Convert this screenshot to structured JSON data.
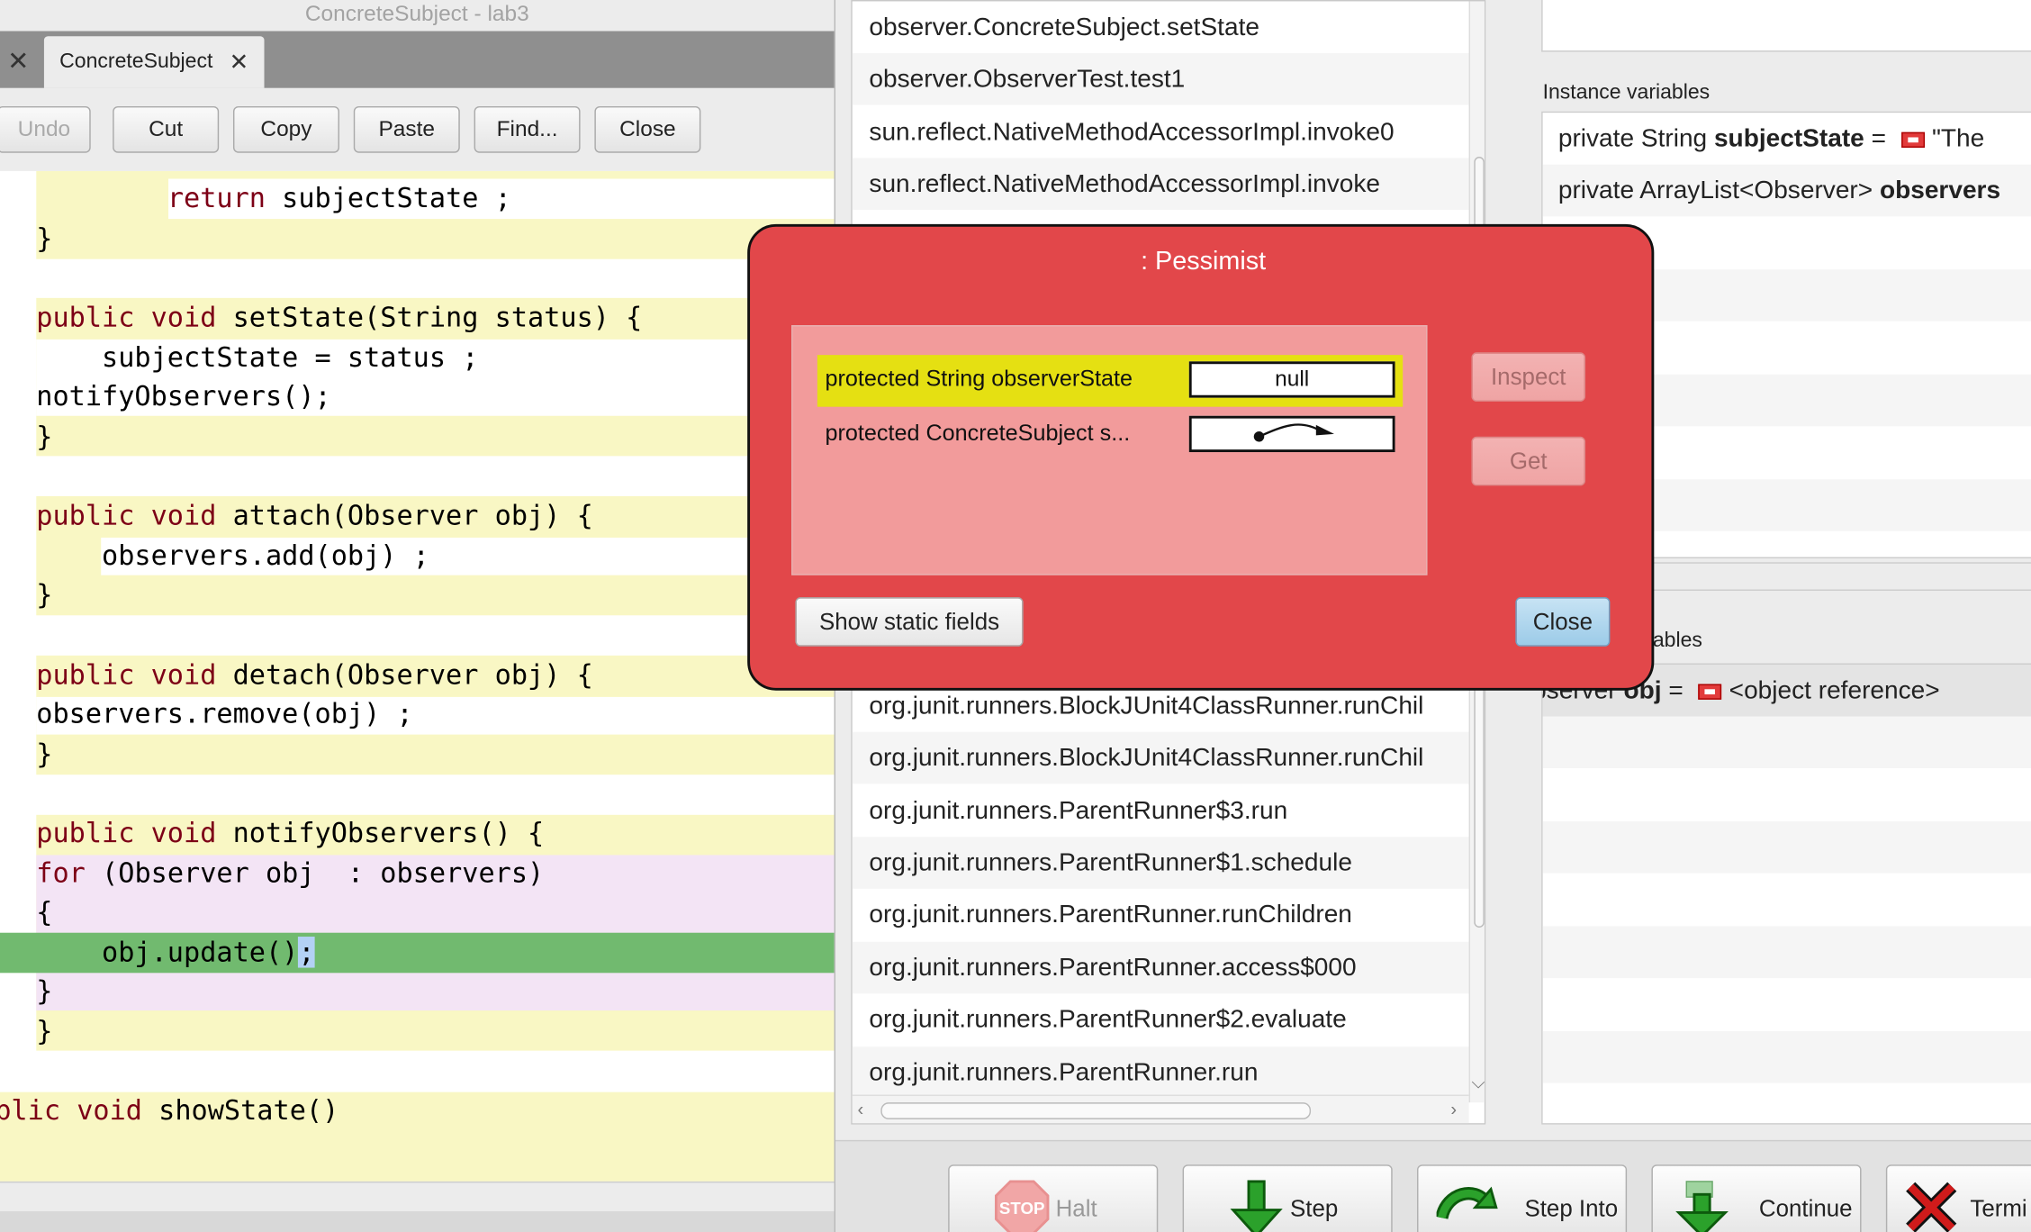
{
  "editor": {
    "window_title": "ConcreteSubject - lab3",
    "tab_close_glyph": "✕",
    "tab": {
      "label": "ConcreteSubject",
      "close_glyph": "✕"
    },
    "toolbar": {
      "undo": "Undo",
      "cut": "Cut",
      "copy": "Copy",
      "paste": "Paste",
      "find": "Find...",
      "close": "Close"
    },
    "code_lines": [
      {
        "pre": "        ",
        "kw": "return",
        "post": " subjectState ;"
      },
      {
        "pre": "}",
        "kw": "",
        "post": ""
      },
      {
        "pre": "",
        "kw": "",
        "post": ""
      },
      {
        "pre": "",
        "kw": "public void",
        "post": " setState(String status) {"
      },
      {
        "pre": "    subjectState = status ;",
        "kw": "",
        "post": ""
      },
      {
        "pre": "notifyObservers();",
        "kw": "",
        "post": ""
      },
      {
        "pre": "}",
        "kw": "",
        "post": ""
      },
      {
        "pre": "",
        "kw": "",
        "post": ""
      },
      {
        "pre": "",
        "kw": "public void",
        "post": " attach(Observer obj) {"
      },
      {
        "pre": "    observers.add(obj) ;",
        "kw": "",
        "post": ""
      },
      {
        "pre": "}",
        "kw": "",
        "post": ""
      },
      {
        "pre": "",
        "kw": "",
        "post": ""
      },
      {
        "pre": "",
        "kw": "public void",
        "post": " detach(Observer obj) {"
      },
      {
        "pre": "observers.remove(obj) ;",
        "kw": "",
        "post": ""
      },
      {
        "pre": "}",
        "kw": "",
        "post": ""
      },
      {
        "pre": "",
        "kw": "",
        "post": ""
      },
      {
        "pre": "",
        "kw": "public void",
        "post": " notifyObservers() {"
      },
      {
        "pre": "",
        "kw": "for",
        "post": " (Observer obj  : observers)"
      },
      {
        "pre": "{",
        "kw": "",
        "post": ""
      },
      {
        "pre": "    obj.update()",
        "kw": "",
        "post": ""
      },
      {
        "pre": "}",
        "kw": "",
        "post": ""
      },
      {
        "pre": "}",
        "kw": "",
        "post": ""
      },
      {
        "pre": "",
        "kw": "",
        "post": ""
      },
      {
        "pre": "",
        "kw": "blic void",
        "post": " showState()"
      }
    ],
    "current_line_suffix": ";"
  },
  "debugger": {
    "stack_frames": [
      "observer.ConcreteSubject.setState",
      "observer.ObserverTest.test1",
      "sun.reflect.NativeMethodAccessorImpl.invoke0",
      "sun.reflect.NativeMethodAccessorImpl.invoke",
      "org.junit.runners.BlockJUnit4ClassRunner.runChil",
      "org.junit.runners.BlockJUnit4ClassRunner.runChil",
      "org.junit.runners.ParentRunner$3.run",
      "org.junit.runners.ParentRunner$1.schedule",
      "org.junit.runners.ParentRunner.runChildren",
      "org.junit.runners.ParentRunner.access$000",
      "org.junit.runners.ParentRunner$2.evaluate",
      "org.junit.runners.ParentRunner.run"
    ],
    "instance_label": "Instance variables",
    "instance_vars": [
      {
        "type": "private  String ",
        "name": "subjectState",
        "eq": " = ",
        "value": "\"The"
      },
      {
        "type": "private  ArrayList<Observer> ",
        "name": "observers",
        "eq": "",
        "value": ""
      }
    ],
    "local_label": "ables",
    "local_vars": [
      {
        "type": "bserver ",
        "name": "obj",
        "eq": " = ",
        "value": "<object reference>"
      }
    ],
    "controls": {
      "halt": "Halt",
      "step": "Step",
      "step_into": "Step Into",
      "continue": "Continue",
      "terminate": "Termi"
    },
    "stop_sign_text": "STOP"
  },
  "dialog": {
    "title": ": Pessimist",
    "fields": [
      {
        "label": "protected String observerState",
        "value": "null"
      },
      {
        "label": "protected ConcreteSubject s...",
        "value": ""
      }
    ],
    "inspect": "Inspect",
    "get": "Get",
    "show_static": "Show static fields",
    "close": "Close"
  },
  "colors": {
    "dialog_bg": "#e2474a",
    "field_highlight": "#e5e012",
    "current_line": "#71ba6f",
    "keyword": "#7d0016"
  }
}
